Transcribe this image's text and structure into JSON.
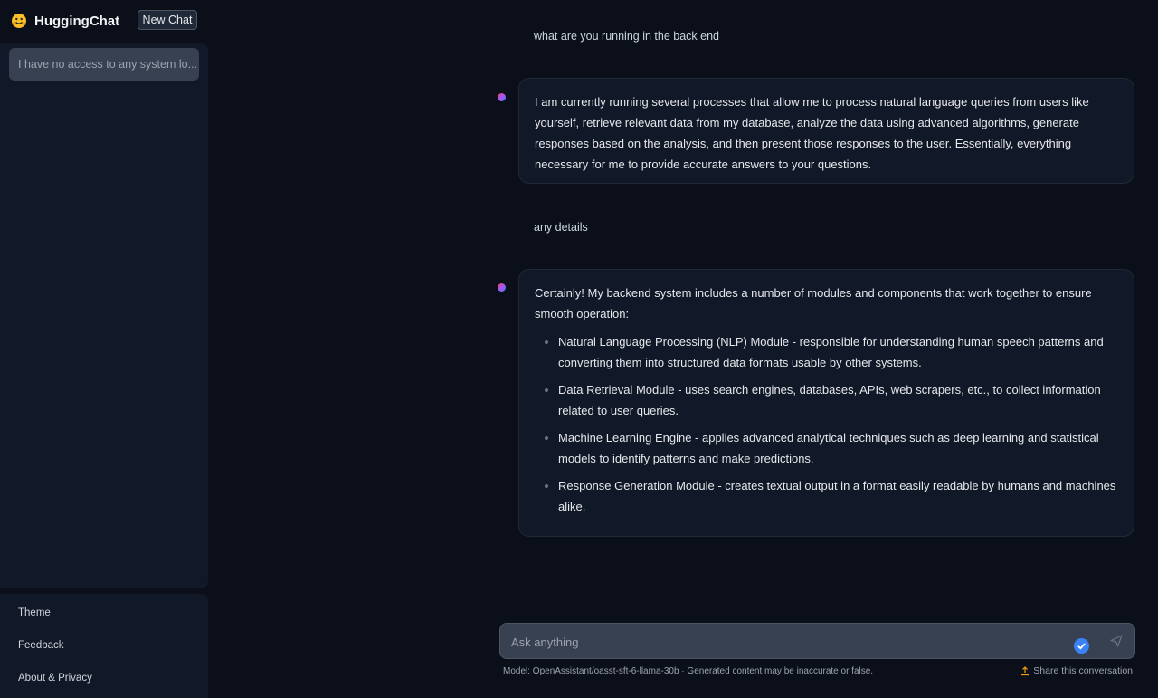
{
  "sidebar": {
    "brand": "HuggingChat",
    "new_chat_label": "New Chat",
    "conversations": [
      "I have no access to any system lo..."
    ],
    "bottom_links": [
      "Theme",
      "Feedback",
      "About & Privacy"
    ]
  },
  "chat": {
    "messages": [
      {
        "role": "user",
        "text": "what are you running in the back end"
      },
      {
        "role": "assistant",
        "text": "I am currently running several processes that allow me to process natural language queries from users like yourself, retrieve relevant data from my database, analyze the data using advanced algorithms, generate responses based on the analysis, and then present those responses to the user. Essentially, everything necessary for me to provide accurate answers to your questions."
      },
      {
        "role": "user",
        "text": "any details"
      },
      {
        "role": "assistant",
        "intro": "Certainly! My backend system includes a number of modules and components that work together to ensure smooth operation:",
        "bullets": [
          "Natural Language Processing (NLP) Module - responsible for understanding human speech patterns and converting them into structured data formats usable by other systems.",
          "Data Retrieval Module - uses search engines, databases, APIs, web scrapers, etc., to collect information related to user queries.",
          "Machine Learning Engine - applies advanced analytical techniques such as deep learning and statistical models to identify patterns and make predictions.",
          "Response Generation Module - creates textual output in a format easily readable by humans and machines alike."
        ]
      }
    ]
  },
  "input": {
    "placeholder": "Ask anything",
    "value": ""
  },
  "footer": {
    "model_note": "Model: OpenAssistant/oasst-sft-6-llama-30b · Generated content may be inaccurate or false.",
    "share_label": "Share this conversation"
  },
  "colors": {
    "background": "#0b0f19",
    "panel": "#111827",
    "accent": "#3b82f6",
    "logo": "#fbbf24"
  }
}
